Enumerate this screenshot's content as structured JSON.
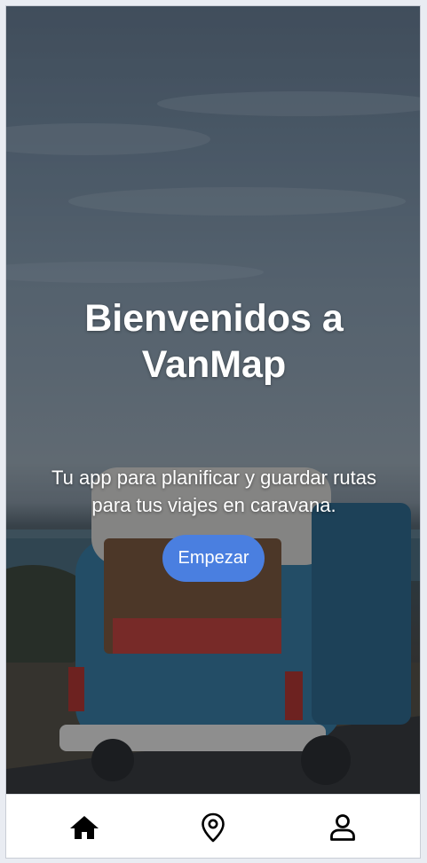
{
  "hero": {
    "title_line1": "Bienvenidos a",
    "title_line2": "VanMap",
    "subtitle_line1": "Tu app para planificar y guardar rutas",
    "subtitle_line2": "para tus viajes en caravana.",
    "background_image": "vintage-camper-van-coast-photo"
  },
  "cta": {
    "label": "Empezar",
    "color": "#4a7fe0"
  },
  "bottom_nav": {
    "items": [
      {
        "icon": "home-icon",
        "active": true
      },
      {
        "icon": "map-pin-icon",
        "active": false
      },
      {
        "icon": "user-icon",
        "active": false
      }
    ]
  }
}
